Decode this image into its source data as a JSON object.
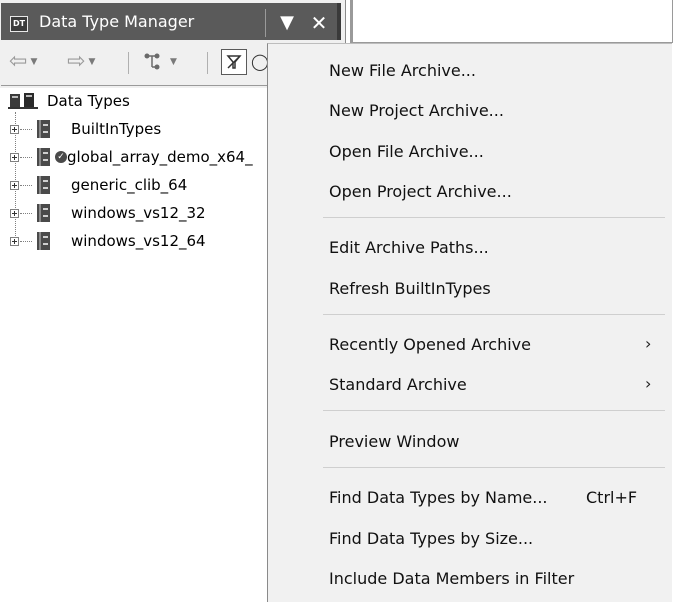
{
  "window": {
    "title": "Data Type Manager",
    "icon_text": "DT"
  },
  "toolbar": {
    "buttons": [
      "back-arrow-icon",
      "forward-arrow-icon",
      "tree-actions-icon",
      "filter-icon"
    ]
  },
  "tree": {
    "root_label": "Data Types",
    "items": [
      {
        "label": "BuiltInTypes",
        "checked": false
      },
      {
        "label": "global_array_demo_x64_",
        "checked": true
      },
      {
        "label": "generic_clib_64",
        "checked": false
      },
      {
        "label": "windows_vs12_32",
        "checked": false
      },
      {
        "label": "windows_vs12_64",
        "checked": false
      }
    ]
  },
  "menu": {
    "new_file_archive": "New File Archive...",
    "new_project_archive": "New Project Archive...",
    "open_file_archive": "Open File Archive...",
    "open_project_archive": "Open Project Archive...",
    "edit_archive_paths": "Edit Archive Paths...",
    "refresh_builtin": "Refresh BuiltInTypes",
    "recently_opened": "Recently Opened Archive",
    "standard_archive": "Standard Archive",
    "preview_window": "Preview Window",
    "find_by_name": "Find Data Types by Name...",
    "find_by_name_shortcut": "Ctrl+F",
    "find_by_size": "Find Data Types by Size...",
    "include_members": "Include Data Members in Filter",
    "submenu_arrow": "›"
  },
  "colors": {
    "title_bar": "#5a5a5a",
    "menu_bg": "#f1f1f1",
    "separator": "#cfcfcf"
  }
}
